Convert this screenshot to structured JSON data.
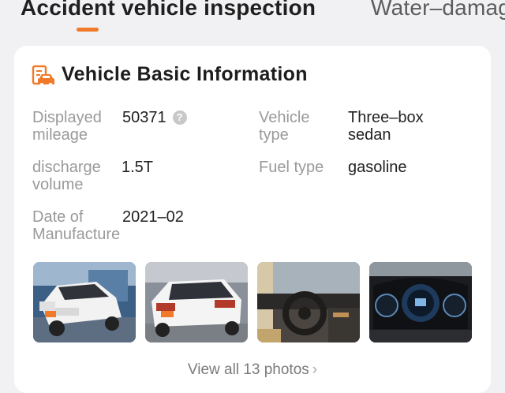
{
  "tabs": {
    "active": "Accident vehicle inspection",
    "inactive": "Water–damag"
  },
  "card": {
    "title": "Vehicle Basic Information",
    "icon": "car-report-icon",
    "accent_color": "#f07a2a",
    "fields": {
      "mileage": {
        "label_line1": "Displayed",
        "label_line2": "mileage",
        "value": "50371"
      },
      "vehicle_type": {
        "label_line1": "Vehicle",
        "label_line2": "type",
        "value_line1": "Three–box",
        "value_line2": "sedan"
      },
      "discharge": {
        "label_line1": "discharge",
        "label_line2": "volume",
        "value": "1.5T"
      },
      "fuel_type": {
        "label": "Fuel type",
        "value": "gasoline"
      },
      "manufacture": {
        "label_line1": "Date of",
        "label_line2": "Manufacture",
        "value": "2021–02"
      }
    },
    "help_glyph": "?",
    "photos": [
      {
        "name": "photo-front-exterior"
      },
      {
        "name": "photo-rear-exterior"
      },
      {
        "name": "photo-interior-steering"
      },
      {
        "name": "photo-dashboard-cluster"
      }
    ],
    "view_all": "View all 13 photos",
    "view_all_chevron": "›"
  }
}
